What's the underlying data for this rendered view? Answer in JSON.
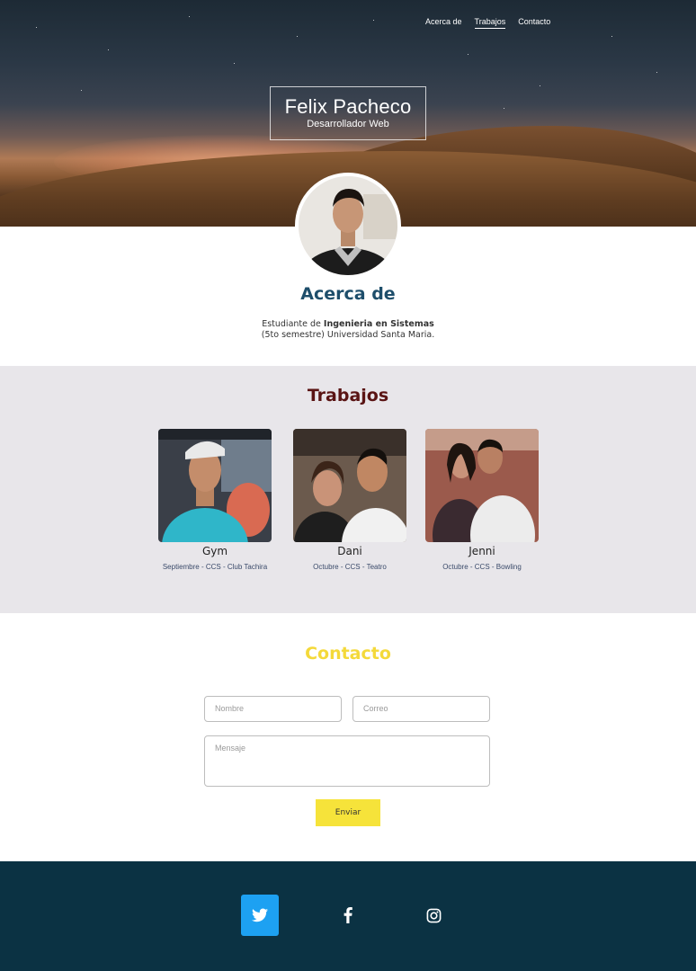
{
  "nav": {
    "items": [
      {
        "label": "Acerca de",
        "active": false
      },
      {
        "label": "Trabajos",
        "active": true
      },
      {
        "label": "Contacto",
        "active": false
      }
    ]
  },
  "hero": {
    "name": "Felix Pacheco",
    "role": "Desarrollador Web"
  },
  "about": {
    "title": "Acerca de",
    "line1_prefix": "Estudiante de ",
    "line1_bold": "Ingenieria en Sistemas",
    "line2": "(5to semestre) Universidad Santa Maria."
  },
  "works": {
    "title": "Trabajos",
    "items": [
      {
        "caption": "Gym",
        "detail": "Septiembre - CCS - Club Tachira"
      },
      {
        "caption": "Dani",
        "detail": "Octubre - CCS - Teatro"
      },
      {
        "caption": "Jenni",
        "detail": "Octubre - CCS - Bowling"
      }
    ]
  },
  "contact": {
    "title": "Contacto",
    "name_placeholder": "Nombre",
    "email_placeholder": "Correo",
    "message_placeholder": "Mensaje",
    "send_label": "Enviar"
  },
  "footer": {
    "social": [
      "twitter-icon",
      "facebook-icon",
      "instagram-icon"
    ]
  },
  "colors": {
    "about_title": "#1e4e6b",
    "works_title": "#5a1414",
    "contact_title": "#f4d93a",
    "send_button": "#f6e33a",
    "footer_bg": "#0b3243",
    "twitter_bg": "#1da1f2"
  }
}
